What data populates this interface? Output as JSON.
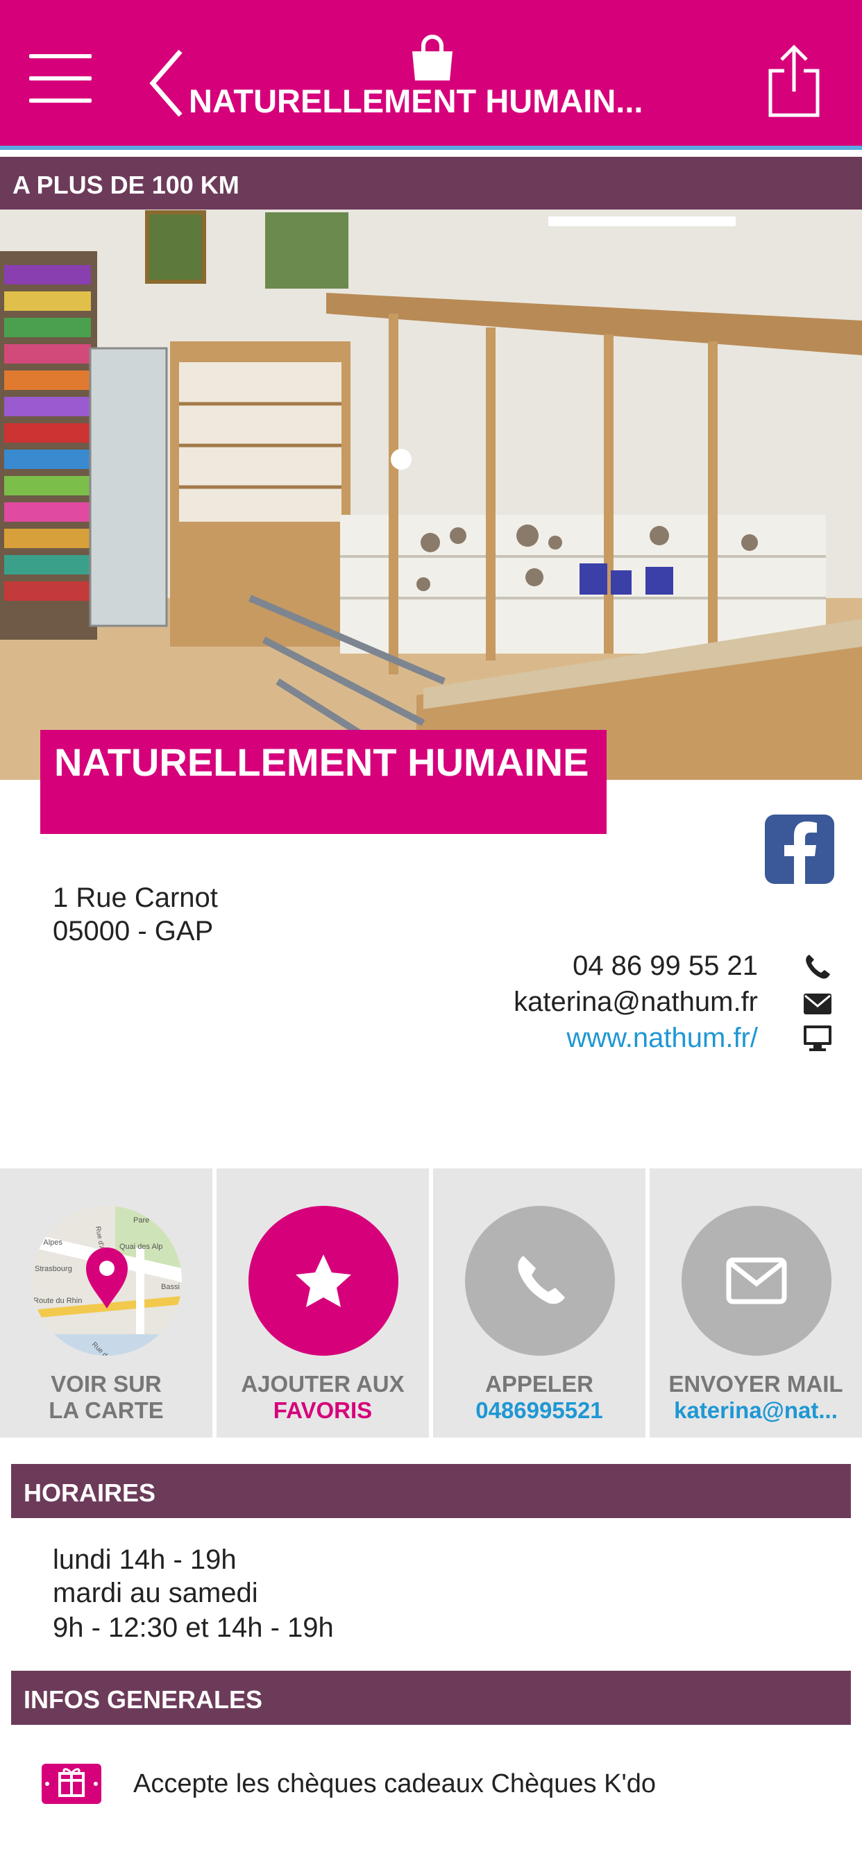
{
  "header": {
    "title": "NATURELLEMENT HUMAIN...",
    "menu_icon": "hamburger-menu-icon",
    "back_icon": "chevron-left-icon",
    "bag_icon": "shopping-bag-icon",
    "share_icon": "share-icon",
    "color": "#d6007a"
  },
  "distance": "A PLUS DE 100 KM",
  "shop": {
    "name": "NATURELLEMENT HUMAINE",
    "address_line1": "1 Rue Carnot",
    "address_line2": "05000 - GAP",
    "phone": "04 86 99 55 21",
    "email": "katerina@nathum.fr",
    "website": "www.nathum.fr/"
  },
  "actions": [
    {
      "line1": "VOIR SUR",
      "line2": "LA CARTE",
      "icon": "map-pin-icon"
    },
    {
      "line1": "AJOUTER AUX",
      "line2": "FAVORIS",
      "icon": "star-icon"
    },
    {
      "line1": "APPELER",
      "line2": "0486995521",
      "icon": "phone-icon"
    },
    {
      "line1": "ENVOYER MAIL",
      "line2": "katerina@nat...",
      "icon": "envelope-icon"
    }
  ],
  "map_thumb": {
    "labels": [
      "is Alpes",
      "Rue d'Ar",
      "Pare",
      "Quai des Alp",
      "Strasbourg",
      "Bassi",
      "Route du Rhin",
      "Rue de M"
    ]
  },
  "sections": {
    "hours_title": "HORAIRES",
    "hours": [
      "lundi 14h - 19h",
      "mardi au samedi",
      "9h - 12:30 et 14h - 19h"
    ],
    "info_title": "INFOS GENERALES",
    "info_text": "Accepte les chèques cadeaux Chèques K'do"
  },
  "colors": {
    "accent": "#d6007a",
    "section": "#6d3b5a",
    "link": "#1f97d4",
    "facebook": "#3b5998",
    "grey_circle": "#b3b3b3"
  }
}
